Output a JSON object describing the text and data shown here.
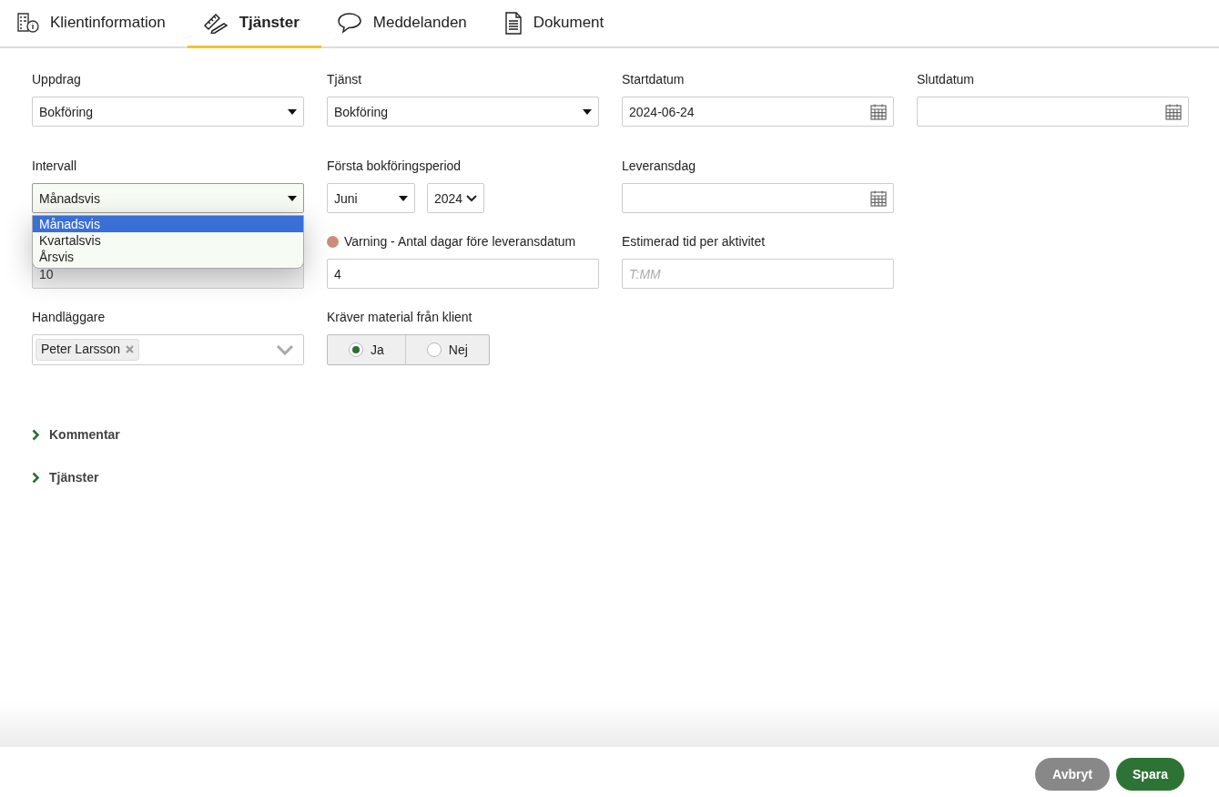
{
  "tabs": [
    {
      "label": "Klientinformation",
      "kind": "info",
      "selected": false
    },
    {
      "label": "Tjänster",
      "kind": "ruler",
      "selected": true
    },
    {
      "label": "Meddelanden",
      "kind": "chat",
      "selected": false
    },
    {
      "label": "Dokument",
      "kind": "doc",
      "selected": false
    }
  ],
  "rows": [
    [
      {
        "kind": "select",
        "label": "Uppdrag",
        "value": "Bokföring"
      },
      {
        "kind": "select",
        "label": "Tjänst",
        "value": "Bokföring"
      },
      {
        "kind": "date",
        "label": "Startdatum",
        "value": "2024-06-24"
      },
      {
        "kind": "date",
        "label": "Slutdatum"
      }
    ],
    [
      {
        "kind": "select",
        "label": "Intervall",
        "value": "Månadsvis",
        "open": true,
        "options": [
          {
            "label": "Månadsvis",
            "selected": true
          },
          {
            "label": "Kvartalsvis",
            "selected": false
          },
          {
            "label": "Årsvis",
            "selected": false
          }
        ]
      },
      {
        "kind": "period",
        "label": "Första bokföringsperiod",
        "month": "Juni",
        "year": "2024"
      },
      {
        "kind": "date",
        "label": "Leveransdag"
      }
    ],
    [
      {
        "kind": "text",
        "value": "10",
        "disabled": true
      },
      {
        "kind": "text",
        "label": "Varning - Antal dagar före leveransdatum",
        "color": "#c8907a",
        "value": "4",
        "disabled": false
      },
      {
        "kind": "text",
        "label": "Estimerad tid per aktivitet",
        "placeholder": "T:MM",
        "disabled": false
      }
    ],
    [
      {
        "kind": "tags",
        "label": "Handläggare",
        "tags": [
          "Peter Larsson"
        ]
      },
      {
        "kind": "radio",
        "label": "Kräver material från klient",
        "options": [
          {
            "label": "Ja",
            "selected": true
          },
          {
            "label": "Nej",
            "selected": false
          }
        ]
      }
    ]
  ],
  "sections": [
    {
      "label": "Kommentar",
      "expanded": false
    },
    {
      "label": "Tjänster",
      "expanded": false
    }
  ],
  "buttons": [
    {
      "label": "Avbryt",
      "kind": "secondary"
    },
    {
      "label": "Spara",
      "kind": "primary"
    }
  ]
}
